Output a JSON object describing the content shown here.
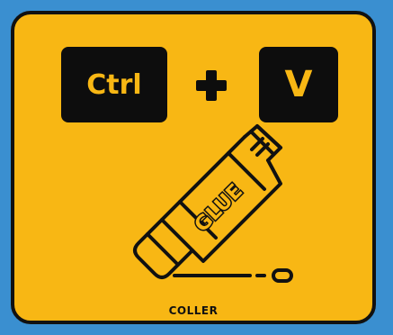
{
  "shortcut": {
    "key1": "Ctrl",
    "key2": "V",
    "plus_icon": "plus-icon"
  },
  "illustration": {
    "icon": "glue-stick-icon",
    "label": "GLUE"
  },
  "caption": "COLLER",
  "colors": {
    "background": "#3a8fd0",
    "card": "#f8b714",
    "key": "#0d0d0d",
    "outline": "#111111"
  }
}
